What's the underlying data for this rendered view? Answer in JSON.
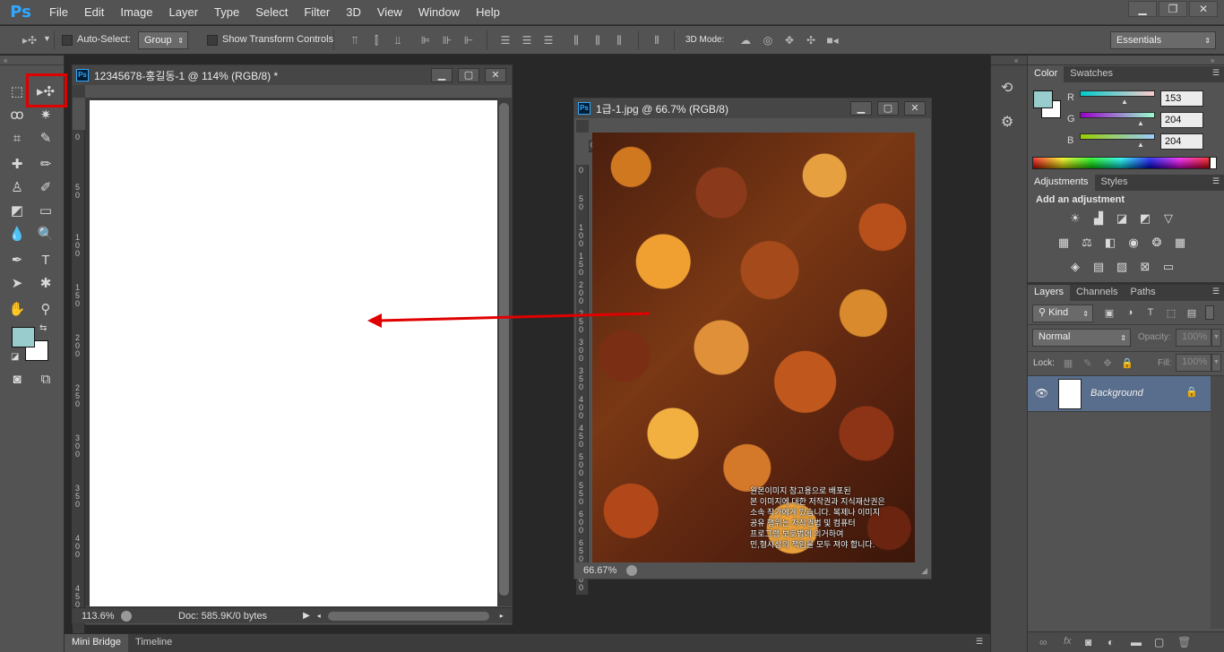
{
  "app": {
    "logo": "Ps"
  },
  "menu": [
    "File",
    "Edit",
    "Image",
    "Layer",
    "Type",
    "Select",
    "Filter",
    "3D",
    "View",
    "Window",
    "Help"
  ],
  "options_bar": {
    "auto_select_label": "Auto-Select:",
    "auto_select_value": "Group",
    "show_transform_label": "Show Transform Controls",
    "mode_3d_label": "3D Mode:",
    "workspace": "Essentials"
  },
  "doc1": {
    "title": "12345678-홍길동-1 @ 114% (RGB/8) *",
    "zoom": "113.6%",
    "doc_size": "Doc: 585.9K/0 bytes",
    "ruler_h": [
      "0",
      "50",
      "100",
      "150",
      "200",
      "250",
      "300",
      "350"
    ],
    "ruler_v": [
      "0",
      "5 0",
      "1 0 0",
      "1 5 0",
      "2 0 0",
      "2 5 0",
      "3 0 0",
      "3 5 0",
      "4 0 0",
      "4 5 0"
    ]
  },
  "doc2": {
    "title": "1급-1.jpg @ 66.7% (RGB/8)",
    "zoom": "66.67%",
    "ruler_h": [
      "0",
      "50",
      "100",
      "150",
      "200",
      "250",
      "300",
      "350",
      "400",
      "450",
      "500",
      "550"
    ],
    "ruler_v": [
      "0",
      "5 0",
      "1 0 0",
      "1 5 0",
      "2 0 0",
      "2 5 0",
      "3 0 0",
      "3 5 0",
      "4 0 0",
      "4 5 0",
      "5 0 0",
      "5 5 0",
      "6 0 0",
      "6 5 0",
      "7 0 0"
    ],
    "watermark": [
      "원본이미지 참고용으로 배포된",
      "본 이미지에 대한 저작권과 지식재산권은",
      "소속 작가에게 있습니다. 복제나 이미지",
      "공유 행위는 저작권법 및 컴퓨터",
      "프로그램 보호법에 의거하여",
      "민,형사상의 책임을 모두 져야 합니다."
    ]
  },
  "color_panel": {
    "tabs": [
      "Color",
      "Swatches"
    ],
    "r_label": "R",
    "g_label": "G",
    "b_label": "B",
    "r": "153",
    "g": "204",
    "b": "204",
    "foreground": "#99cccc"
  },
  "adjustments_panel": {
    "tabs": [
      "Adjustments",
      "Styles"
    ],
    "heading": "Add an adjustment"
  },
  "layers_panel": {
    "tabs": [
      "Layers",
      "Channels",
      "Paths"
    ],
    "filter": "Kind",
    "blend_mode": "Normal",
    "opacity_label": "Opacity:",
    "opacity": "100%",
    "lock_label": "Lock:",
    "fill_label": "Fill:",
    "fill": "100%",
    "layer_name": "Background"
  },
  "bottom_tabs": [
    "Mini Bridge",
    "Timeline"
  ],
  "colors": {
    "accent": "#31a8ff",
    "annotation": "#e00000"
  }
}
